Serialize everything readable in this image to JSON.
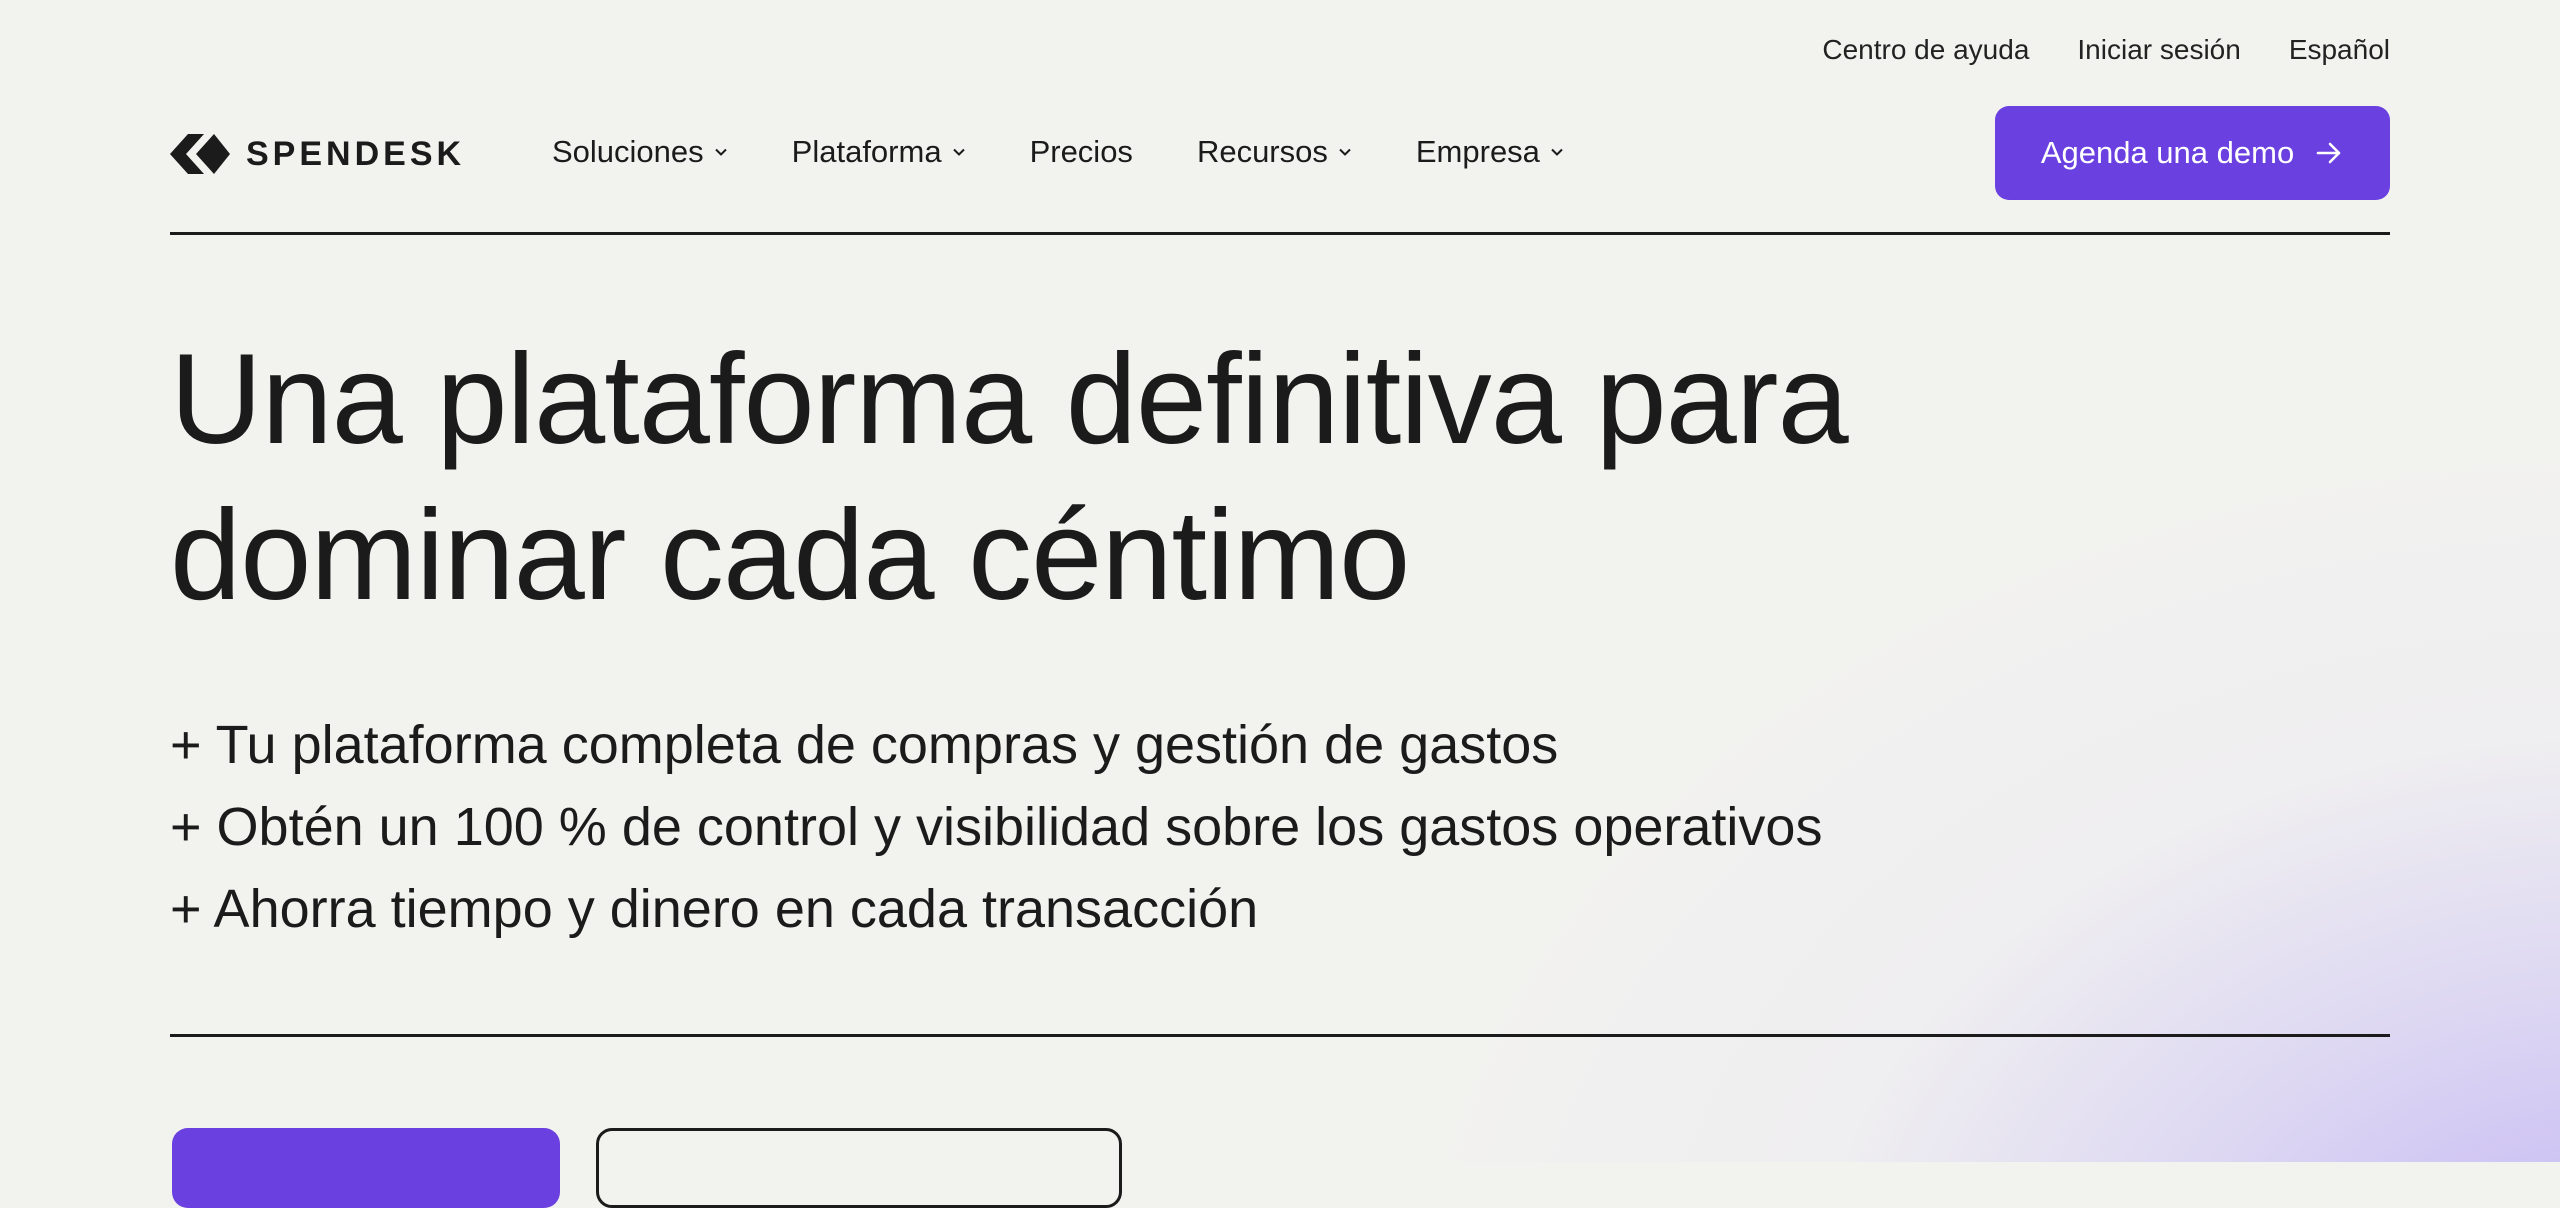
{
  "utility_nav": {
    "help": "Centro de ayuda",
    "login": "Iniciar sesión",
    "language": "Español"
  },
  "brand": {
    "name": "SPENDESK",
    "logo_icon": "spendesk-logo-icon"
  },
  "nav": {
    "items": [
      {
        "label": "Soluciones",
        "dropdown": true
      },
      {
        "label": "Plataforma",
        "dropdown": true
      },
      {
        "label": "Precios",
        "dropdown": false
      },
      {
        "label": "Recursos",
        "dropdown": true
      },
      {
        "label": "Empresa",
        "dropdown": true
      }
    ],
    "cta_label": "Agenda una demo"
  },
  "hero": {
    "title_line1": "Una plataforma definitiva para",
    "title_line2": "dominar cada céntimo",
    "bullets": [
      "+ Tu plataforma completa de compras y gestión de gastos",
      "+ Obtén un 100 % de control y visibilidad sobre los gastos operativos",
      "+ Ahorra tiempo y dinero en cada transacción"
    ]
  },
  "colors": {
    "accent": "#6a40e0",
    "text": "#1b1b1b",
    "background": "#f2f2ef",
    "glow": "#bfaff5"
  }
}
